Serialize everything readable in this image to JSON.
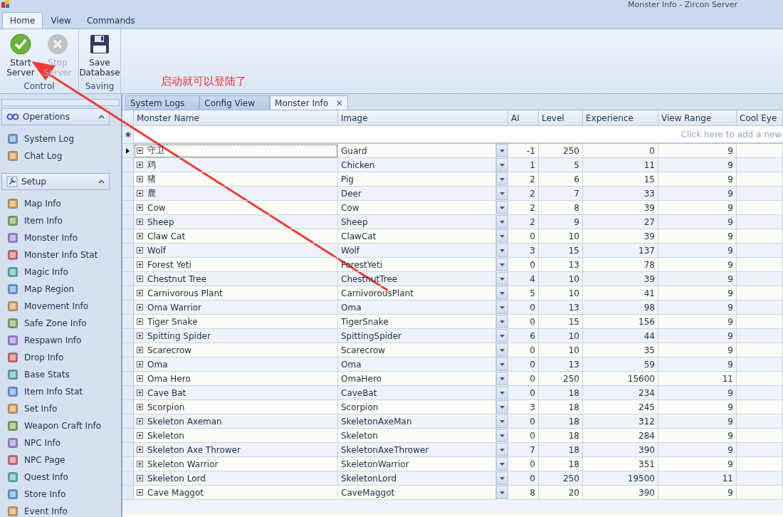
{
  "window": {
    "title": "Monster Info - Zircon Server"
  },
  "ribbon": {
    "tabs": [
      {
        "label": "Home",
        "selected": true
      },
      {
        "label": "View",
        "selected": false
      },
      {
        "label": "Commands",
        "selected": false
      }
    ],
    "groups": [
      {
        "label": "Control",
        "buttons": [
          {
            "kind": "start",
            "label": "Start Server",
            "disabled": false
          },
          {
            "kind": "stop",
            "label": "Stop Server",
            "disabled": true
          }
        ]
      },
      {
        "label": "Saving",
        "buttons": [
          {
            "kind": "save",
            "label": "Save Database",
            "disabled": false
          }
        ]
      }
    ]
  },
  "annotation": {
    "text": "启动就可以登陆了"
  },
  "sidebar": {
    "groups": [
      {
        "kind": "operations",
        "label": "Operations",
        "expanded": true,
        "items": [
          "System Log",
          "Chat Log"
        ]
      },
      {
        "kind": "setup",
        "label": "Setup",
        "expanded": true,
        "items": [
          "Map Info",
          "Item Info",
          "Monster Info",
          "Monster Info Stat",
          "Magic Info",
          "Map Region",
          "Movement Info",
          "Safe Zone Info",
          "Respawn Info",
          "Drop Info",
          "Base Stats",
          "Item Info Stat",
          "Set Info",
          "Weapon Craft Info",
          "NPC Info",
          "NPC Page",
          "Quest Info",
          "Store Info",
          "Event Info"
        ]
      }
    ]
  },
  "doc_tabs": [
    {
      "label": "System Logs",
      "selected": false
    },
    {
      "label": "Config View",
      "selected": false
    },
    {
      "label": "Monster Info",
      "selected": true,
      "close": "×"
    }
  ],
  "table": {
    "columns": [
      "Monster Name",
      "Image",
      "AI",
      "Level",
      "Experience",
      "View Range",
      "Cool Eye"
    ],
    "new_row_hint": "Click here to add a new",
    "rows": [
      {
        "name": "守卫",
        "image": "Guard",
        "ai": "-1",
        "level": "250",
        "experience": "0",
        "view_range": "9",
        "selected": true
      },
      {
        "name": "鸡",
        "image": "Chicken",
        "ai": "1",
        "level": "5",
        "experience": "11",
        "view_range": "9",
        "selected": false
      },
      {
        "name": "猪",
        "image": "Pig",
        "ai": "2",
        "level": "6",
        "experience": "15",
        "view_range": "9",
        "selected": false
      },
      {
        "name": "鹿",
        "image": "Deer",
        "ai": "2",
        "level": "7",
        "experience": "33",
        "view_range": "9",
        "selected": false
      },
      {
        "name": "Cow",
        "image": "Cow",
        "ai": "2",
        "level": "8",
        "experience": "39",
        "view_range": "9",
        "selected": false
      },
      {
        "name": "Sheep",
        "image": "Sheep",
        "ai": "2",
        "level": "9",
        "experience": "27",
        "view_range": "9",
        "selected": false
      },
      {
        "name": "Claw Cat",
        "image": "ClawCat",
        "ai": "0",
        "level": "10",
        "experience": "39",
        "view_range": "9",
        "selected": false
      },
      {
        "name": "Wolf",
        "image": "Wolf",
        "ai": "3",
        "level": "15",
        "experience": "137",
        "view_range": "9",
        "selected": false
      },
      {
        "name": "Forest Yeti",
        "image": "ForestYeti",
        "ai": "0",
        "level": "13",
        "experience": "78",
        "view_range": "9",
        "selected": false
      },
      {
        "name": "Chestnut Tree",
        "image": "ChestnutTree",
        "ai": "4",
        "level": "10",
        "experience": "39",
        "view_range": "9",
        "selected": false
      },
      {
        "name": "Carnivorous Plant",
        "image": "CarnivorousPlant",
        "ai": "5",
        "level": "10",
        "experience": "41",
        "view_range": "9",
        "selected": false
      },
      {
        "name": "Oma Warrior",
        "image": "Oma",
        "ai": "0",
        "level": "13",
        "experience": "98",
        "view_range": "9",
        "selected": false
      },
      {
        "name": "Tiger Snake",
        "image": "TigerSnake",
        "ai": "0",
        "level": "15",
        "experience": "156",
        "view_range": "9",
        "selected": false
      },
      {
        "name": "Spitting Spider",
        "image": "SpittingSpider",
        "ai": "6",
        "level": "10",
        "experience": "44",
        "view_range": "9",
        "selected": false
      },
      {
        "name": "Scarecrow",
        "image": "Scarecrow",
        "ai": "0",
        "level": "10",
        "experience": "35",
        "view_range": "9",
        "selected": false
      },
      {
        "name": "Oma",
        "image": "Oma",
        "ai": "0",
        "level": "13",
        "experience": "59",
        "view_range": "9",
        "selected": false
      },
      {
        "name": "Oma Hero",
        "image": "OmaHero",
        "ai": "0",
        "level": "250",
        "experience": "15600",
        "view_range": "11",
        "selected": false
      },
      {
        "name": "Cave Bat",
        "image": "CaveBat",
        "ai": "0",
        "level": "18",
        "experience": "234",
        "view_range": "9",
        "selected": false
      },
      {
        "name": "Scorpion",
        "image": "Scorpion",
        "ai": "3",
        "level": "18",
        "experience": "245",
        "view_range": "9",
        "selected": false
      },
      {
        "name": "Skeleton Axeman",
        "image": "SkeletonAxeMan",
        "ai": "0",
        "level": "18",
        "experience": "312",
        "view_range": "9",
        "selected": false
      },
      {
        "name": "Skeleton",
        "image": "Skeleton",
        "ai": "0",
        "level": "18",
        "experience": "284",
        "view_range": "9",
        "selected": false
      },
      {
        "name": "Skeleton Axe Thrower",
        "image": "SkeletonAxeThrower",
        "ai": "7",
        "level": "18",
        "experience": "390",
        "view_range": "9",
        "selected": false
      },
      {
        "name": "Skeleton Warrior",
        "image": "SkeletonWarrior",
        "ai": "0",
        "level": "18",
        "experience": "351",
        "view_range": "9",
        "selected": false
      },
      {
        "name": "Skeleton Lord",
        "image": "SkeletonLord",
        "ai": "0",
        "level": "250",
        "experience": "19500",
        "view_range": "11",
        "selected": false
      },
      {
        "name": "Cave Maggot",
        "image": "CaveMaggot",
        "ai": "8",
        "level": "20",
        "experience": "390",
        "view_range": "9",
        "selected": false
      }
    ]
  }
}
